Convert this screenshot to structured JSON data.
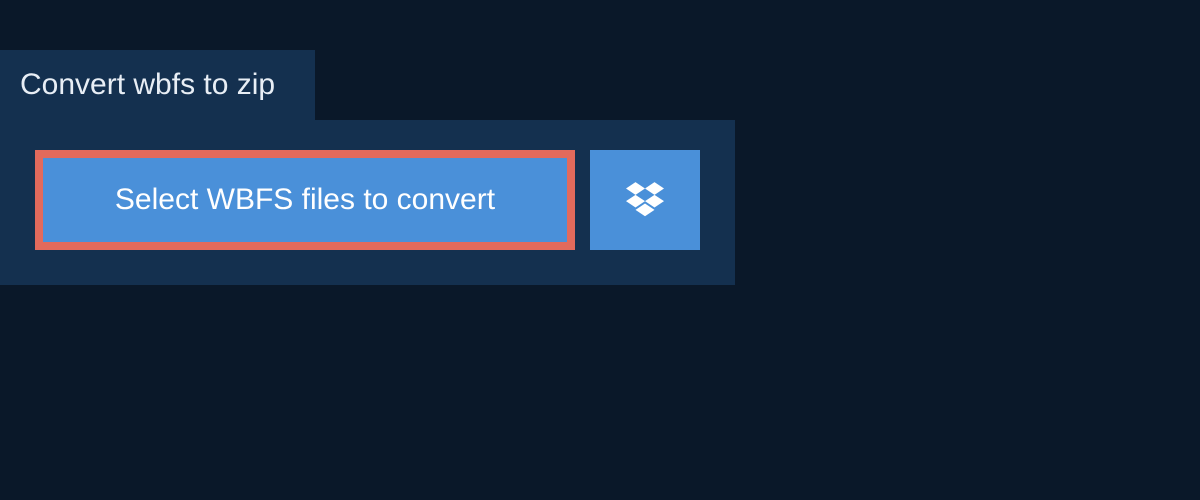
{
  "tab": {
    "title": "Convert wbfs to zip"
  },
  "buttons": {
    "select_label": "Select WBFS files to convert"
  },
  "colors": {
    "background": "#0a1829",
    "panel": "#14304f",
    "button": "#4a90d9",
    "highlight_border": "#e26a5c",
    "text_light": "#e8eef5",
    "text_button": "#ffffff"
  }
}
